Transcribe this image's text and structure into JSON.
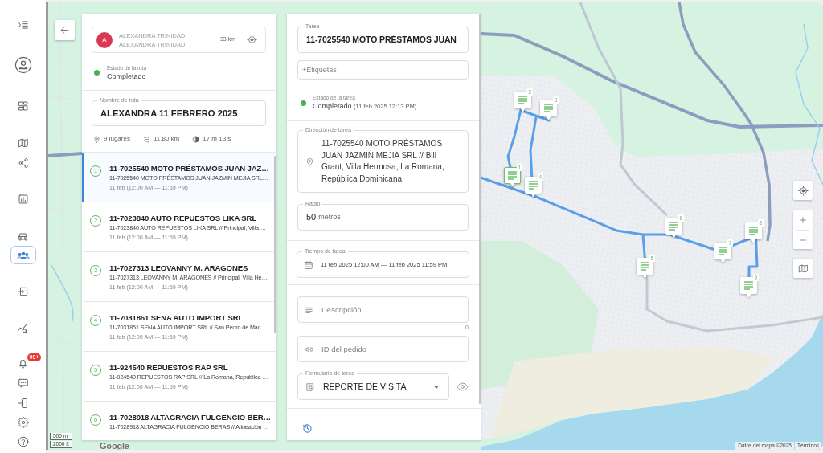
{
  "sidebar": {
    "items": [
      {
        "selected": false
      },
      {
        "selected": false
      },
      {
        "selected": false
      },
      {
        "selected": false
      },
      {
        "selected": false
      },
      {
        "selected": false
      },
      {
        "selected": false
      },
      {
        "selected": true
      },
      {
        "selected": false
      },
      {
        "selected": false
      },
      {
        "selected": false,
        "badge": "99+"
      },
      {
        "selected": false
      },
      {
        "selected": false
      },
      {
        "selected": false
      },
      {
        "selected": false
      }
    ]
  },
  "route_panel": {
    "driver": {
      "initial": "A",
      "name": "ALEXANDRA TRINIDAD",
      "subtitle": "ALEXANDRA TRINIDAD",
      "distance": "33 km"
    },
    "status": {
      "label": "Estado de la ruta",
      "value": "Completado"
    },
    "route_name": {
      "label": "Nombre de ruta",
      "value": "ALEXANDRA 11 FEBRERO 2025"
    },
    "stats": [
      "9 lugares",
      "11.80 km",
      "17 m 13 s"
    ],
    "tasks": [
      {
        "number": "1",
        "title": "11-7025540 MOTO PRÉSTAMOS JUAN JAZ…",
        "address": "11-7025540 MOTO PRÉSTAMOS JUAN JAZMIN MEJIA SRL…",
        "time": "11 feb (12:00 AM — 11:59 PM)",
        "selected": true
      },
      {
        "number": "2",
        "title": "11-7023840 AUTO REPUESTOS LIKA SRL",
        "address": "11-7023840 AUTO REPUESTOS LIKA SRL // Principal, Villa …",
        "time": "11 feb (12:00 AM — 11:59 PM)",
        "selected": false
      },
      {
        "number": "3",
        "title": "11-7027313 LEOVANNY M. ARAGONES",
        "address": "11-7027313 LEOVANNY M. ARAGONES // Principal, Villa He…",
        "time": "11 feb (12:00 AM — 11:59 PM)",
        "selected": false
      },
      {
        "number": "4",
        "title": "11-7031851 SENA AUTO IMPORT SRL",
        "address": "11-7031851 SENA AUTO IMPORT SRL // San Pedro de Mac…",
        "time": "11 feb (12:00 AM — 11:59 PM)",
        "selected": false
      },
      {
        "number": "5",
        "title": "11-924540 REPUESTOS RAP SRL",
        "address": "11-924540 REPUESTOS RAP SRL // La Romana, República …",
        "time": "11 feb (12:00 AM — 11:59 PM)",
        "selected": false
      },
      {
        "number": "6",
        "title": "11-7028918 ALTAGRACIA FULGENCIO BER…",
        "address": "11-7028918 ALTAGRACIA FULGENCIO BERAS // Alineación …",
        "selected": false
      }
    ]
  },
  "task_panel": {
    "task_field": {
      "label": "Tarea",
      "value": "11-7025540 MOTO PRÉSTAMOS JUAN"
    },
    "tags_field": {
      "placeholder": "+Etiquetas"
    },
    "status": {
      "label": "Estado de la tarea",
      "value": "Completado",
      "timestamp": "(11 feb 2025 12:13 PM)"
    },
    "address_field": {
      "label": "Dirección de tarea",
      "value": "11-7025540 MOTO PRÉSTAMOS JUAN JAZMIN MEJIA SRL // Bill Grant, Villa Hermosa, La Romana, República Dominicana"
    },
    "radius_field": {
      "label": "Radio",
      "value": "50",
      "unit": "metros"
    },
    "time_field": {
      "label": "Tiempo de tarea",
      "value": "11 feb 2025 12:00 AM — 11 feb 2025 11:59 PM"
    },
    "description_field": {
      "placeholder": "Descripción",
      "counter": "0"
    },
    "order_id_field": {
      "placeholder": "ID del pedido"
    },
    "form_select": {
      "label": "Formulario de tarea",
      "value": "REPORTE DE VISITA"
    }
  },
  "map": {
    "markers": [
      {
        "number": "1",
        "selected": true
      },
      {
        "number": "2",
        "selected": false
      },
      {
        "number": "3",
        "selected": false
      },
      {
        "number": "4",
        "selected": false
      },
      {
        "number": "5",
        "selected": false
      },
      {
        "number": "6",
        "selected": false
      },
      {
        "number": "7",
        "selected": false
      },
      {
        "number": "8",
        "selected": false
      },
      {
        "number": "9",
        "selected": false
      }
    ],
    "scale": [
      "500 m",
      "2000 ft"
    ],
    "logo": "Google",
    "attribution": "Datos del mapa ©2025",
    "terms": "Términos"
  }
}
